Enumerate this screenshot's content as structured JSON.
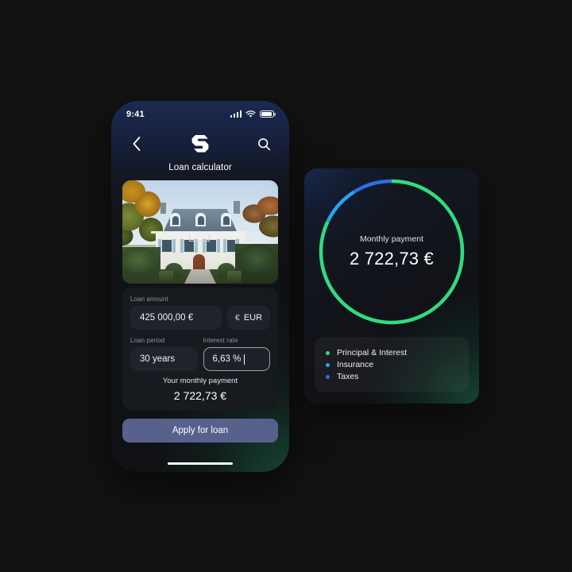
{
  "phone": {
    "status_bar": {
      "time": "9:41",
      "icons": [
        "cellular-signal-icon",
        "wifi-icon",
        "battery-icon"
      ]
    },
    "nav": {
      "back_icon": "chevron-left-icon",
      "logo": "s-logo-icon",
      "search_icon": "search-icon"
    },
    "screen_title": "Loan calculator",
    "photo_alt": "house-photo",
    "form": {
      "loan_amount_label": "Loan amount",
      "loan_amount_value": "425 000,00 €",
      "currency_symbol": "€",
      "currency_code": "EUR",
      "loan_period_label": "Loan period",
      "loan_period_value": "30 years",
      "interest_rate_label": "Interest rate",
      "interest_rate_value": "6,63 %"
    },
    "summary": {
      "label": "Your monthly payment",
      "value": "2 722,73 €"
    },
    "apply_label": "Apply for loan"
  },
  "panel": {
    "donut": {
      "label": "Monthly payment",
      "value": "2 722,73 €"
    },
    "legend": [
      {
        "label": "Principal & Interest",
        "color": "#2fdd7f"
      },
      {
        "label": "Insurance",
        "color": "#29a3f0"
      },
      {
        "label": "Taxes",
        "color": "#2f6de0"
      }
    ]
  },
  "chart_data": {
    "type": "pie",
    "title": "Monthly payment",
    "center_label": "Monthly payment",
    "center_value": "2 722,73 €",
    "total": 2722.73,
    "unit": "€",
    "categories": [
      "Principal & Interest",
      "Insurance",
      "Taxes"
    ],
    "values": [
      82,
      9,
      9
    ],
    "value_unit": "percent",
    "colors": [
      "#2fdd7f",
      "#29a3f0",
      "#2f6de0"
    ],
    "start_angle_deg": 0,
    "direction": "clockwise",
    "donut_hole_ratio": 0.92,
    "legend_position": "bottom",
    "grid": false
  }
}
